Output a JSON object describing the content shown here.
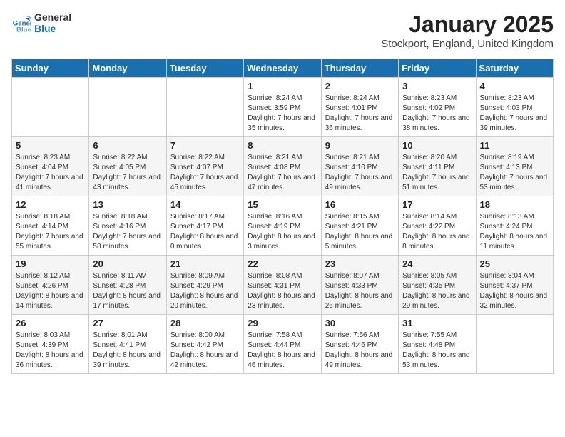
{
  "logo": {
    "line1": "General",
    "line2": "Blue"
  },
  "title": "January 2025",
  "location": "Stockport, England, United Kingdom",
  "weekdays": [
    "Sunday",
    "Monday",
    "Tuesday",
    "Wednesday",
    "Thursday",
    "Friday",
    "Saturday"
  ],
  "weeks": [
    [
      {
        "day": "",
        "sunrise": "",
        "sunset": "",
        "daylight": ""
      },
      {
        "day": "",
        "sunrise": "",
        "sunset": "",
        "daylight": ""
      },
      {
        "day": "",
        "sunrise": "",
        "sunset": "",
        "daylight": ""
      },
      {
        "day": "1",
        "sunrise": "Sunrise: 8:24 AM",
        "sunset": "Sunset: 3:59 PM",
        "daylight": "Daylight: 7 hours and 35 minutes."
      },
      {
        "day": "2",
        "sunrise": "Sunrise: 8:24 AM",
        "sunset": "Sunset: 4:01 PM",
        "daylight": "Daylight: 7 hours and 36 minutes."
      },
      {
        "day": "3",
        "sunrise": "Sunrise: 8:23 AM",
        "sunset": "Sunset: 4:02 PM",
        "daylight": "Daylight: 7 hours and 38 minutes."
      },
      {
        "day": "4",
        "sunrise": "Sunrise: 8:23 AM",
        "sunset": "Sunset: 4:03 PM",
        "daylight": "Daylight: 7 hours and 39 minutes."
      }
    ],
    [
      {
        "day": "5",
        "sunrise": "Sunrise: 8:23 AM",
        "sunset": "Sunset: 4:04 PM",
        "daylight": "Daylight: 7 hours and 41 minutes."
      },
      {
        "day": "6",
        "sunrise": "Sunrise: 8:22 AM",
        "sunset": "Sunset: 4:05 PM",
        "daylight": "Daylight: 7 hours and 43 minutes."
      },
      {
        "day": "7",
        "sunrise": "Sunrise: 8:22 AM",
        "sunset": "Sunset: 4:07 PM",
        "daylight": "Daylight: 7 hours and 45 minutes."
      },
      {
        "day": "8",
        "sunrise": "Sunrise: 8:21 AM",
        "sunset": "Sunset: 4:08 PM",
        "daylight": "Daylight: 7 hours and 47 minutes."
      },
      {
        "day": "9",
        "sunrise": "Sunrise: 8:21 AM",
        "sunset": "Sunset: 4:10 PM",
        "daylight": "Daylight: 7 hours and 49 minutes."
      },
      {
        "day": "10",
        "sunrise": "Sunrise: 8:20 AM",
        "sunset": "Sunset: 4:11 PM",
        "daylight": "Daylight: 7 hours and 51 minutes."
      },
      {
        "day": "11",
        "sunrise": "Sunrise: 8:19 AM",
        "sunset": "Sunset: 4:13 PM",
        "daylight": "Daylight: 7 hours and 53 minutes."
      }
    ],
    [
      {
        "day": "12",
        "sunrise": "Sunrise: 8:18 AM",
        "sunset": "Sunset: 4:14 PM",
        "daylight": "Daylight: 7 hours and 55 minutes."
      },
      {
        "day": "13",
        "sunrise": "Sunrise: 8:18 AM",
        "sunset": "Sunset: 4:16 PM",
        "daylight": "Daylight: 7 hours and 58 minutes."
      },
      {
        "day": "14",
        "sunrise": "Sunrise: 8:17 AM",
        "sunset": "Sunset: 4:17 PM",
        "daylight": "Daylight: 8 hours and 0 minutes."
      },
      {
        "day": "15",
        "sunrise": "Sunrise: 8:16 AM",
        "sunset": "Sunset: 4:19 PM",
        "daylight": "Daylight: 8 hours and 3 minutes."
      },
      {
        "day": "16",
        "sunrise": "Sunrise: 8:15 AM",
        "sunset": "Sunset: 4:21 PM",
        "daylight": "Daylight: 8 hours and 5 minutes."
      },
      {
        "day": "17",
        "sunrise": "Sunrise: 8:14 AM",
        "sunset": "Sunset: 4:22 PM",
        "daylight": "Daylight: 8 hours and 8 minutes."
      },
      {
        "day": "18",
        "sunrise": "Sunrise: 8:13 AM",
        "sunset": "Sunset: 4:24 PM",
        "daylight": "Daylight: 8 hours and 11 minutes."
      }
    ],
    [
      {
        "day": "19",
        "sunrise": "Sunrise: 8:12 AM",
        "sunset": "Sunset: 4:26 PM",
        "daylight": "Daylight: 8 hours and 14 minutes."
      },
      {
        "day": "20",
        "sunrise": "Sunrise: 8:11 AM",
        "sunset": "Sunset: 4:28 PM",
        "daylight": "Daylight: 8 hours and 17 minutes."
      },
      {
        "day": "21",
        "sunrise": "Sunrise: 8:09 AM",
        "sunset": "Sunset: 4:29 PM",
        "daylight": "Daylight: 8 hours and 20 minutes."
      },
      {
        "day": "22",
        "sunrise": "Sunrise: 8:08 AM",
        "sunset": "Sunset: 4:31 PM",
        "daylight": "Daylight: 8 hours and 23 minutes."
      },
      {
        "day": "23",
        "sunrise": "Sunrise: 8:07 AM",
        "sunset": "Sunset: 4:33 PM",
        "daylight": "Daylight: 8 hours and 26 minutes."
      },
      {
        "day": "24",
        "sunrise": "Sunrise: 8:05 AM",
        "sunset": "Sunset: 4:35 PM",
        "daylight": "Daylight: 8 hours and 29 minutes."
      },
      {
        "day": "25",
        "sunrise": "Sunrise: 8:04 AM",
        "sunset": "Sunset: 4:37 PM",
        "daylight": "Daylight: 8 hours and 32 minutes."
      }
    ],
    [
      {
        "day": "26",
        "sunrise": "Sunrise: 8:03 AM",
        "sunset": "Sunset: 4:39 PM",
        "daylight": "Daylight: 8 hours and 36 minutes."
      },
      {
        "day": "27",
        "sunrise": "Sunrise: 8:01 AM",
        "sunset": "Sunset: 4:41 PM",
        "daylight": "Daylight: 8 hours and 39 minutes."
      },
      {
        "day": "28",
        "sunrise": "Sunrise: 8:00 AM",
        "sunset": "Sunset: 4:42 PM",
        "daylight": "Daylight: 8 hours and 42 minutes."
      },
      {
        "day": "29",
        "sunrise": "Sunrise: 7:58 AM",
        "sunset": "Sunset: 4:44 PM",
        "daylight": "Daylight: 8 hours and 46 minutes."
      },
      {
        "day": "30",
        "sunrise": "Sunrise: 7:56 AM",
        "sunset": "Sunset: 4:46 PM",
        "daylight": "Daylight: 8 hours and 49 minutes."
      },
      {
        "day": "31",
        "sunrise": "Sunrise: 7:55 AM",
        "sunset": "Sunset: 4:48 PM",
        "daylight": "Daylight: 8 hours and 53 minutes."
      },
      {
        "day": "",
        "sunrise": "",
        "sunset": "",
        "daylight": ""
      }
    ]
  ]
}
